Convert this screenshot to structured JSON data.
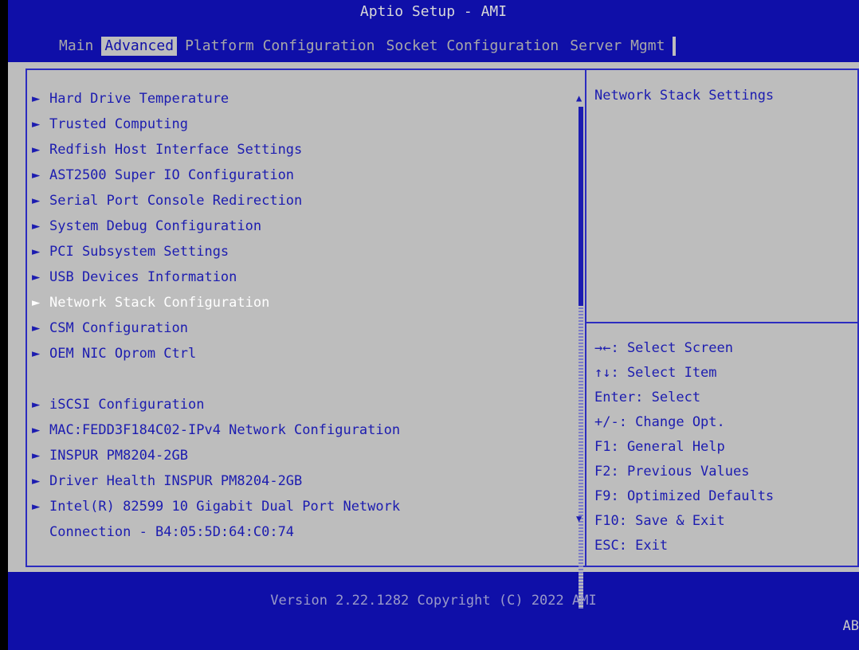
{
  "title": "Aptio Setup - AMI",
  "tabs": [
    "Main",
    "Advanced",
    "Platform Configuration",
    "Socket Configuration",
    "Server Mgmt"
  ],
  "menu": [
    "Hard Drive Temperature",
    "Trusted Computing",
    "Redfish Host Interface Settings",
    "AST2500 Super IO Configuration",
    "Serial Port Console Redirection",
    "System Debug Configuration",
    "PCI Subsystem Settings",
    "USB Devices Information",
    "Network Stack Configuration",
    "CSM Configuration",
    "OEM NIC Oprom Ctrl",
    "",
    "iSCSI Configuration",
    "MAC:FEDD3F184C02-IPv4 Network Configuration",
    "INSPUR PM8204-2GB",
    "Driver Health INSPUR PM8204-2GB",
    "Intel(R) 82599 10 Gigabit Dual Port Network",
    "Connection - B4:05:5D:64:C0:74"
  ],
  "selected_index": 8,
  "help_text": "Network Stack Settings",
  "keys": [
    "→←: Select Screen",
    "↑↓: Select Item",
    "Enter: Select",
    "+/-: Change Opt.",
    "F1: General Help",
    "F2: Previous Values",
    "F9: Optimized Defaults",
    "F10: Save & Exit",
    "ESC: Exit"
  ],
  "footer": "Version 2.22.1282 Copyright (C) 2022 AMI",
  "corner": "AB",
  "colors": {
    "background": "#0f0fa8",
    "panel": "#bdbdbd",
    "text": "#1c1cb0",
    "selected": "#ffffff"
  }
}
